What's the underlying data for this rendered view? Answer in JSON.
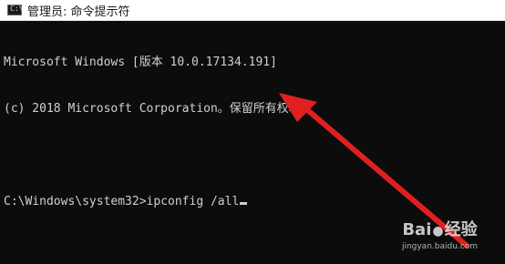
{
  "window": {
    "title": "管理员: 命令提示符",
    "icon": "console-icon"
  },
  "console": {
    "lines": [
      "Microsoft Windows [版本 10.0.17134.191]",
      "(c) 2018 Microsoft Corporation。保留所有权利。",
      "",
      "C:\\Windows\\system32>ipconfig /all"
    ]
  },
  "annotation": {
    "arrow_color": "#e02020"
  },
  "watermark": {
    "logo_left": "Bai",
    "logo_right": "经验",
    "url": "jingyan.baidu.com"
  }
}
